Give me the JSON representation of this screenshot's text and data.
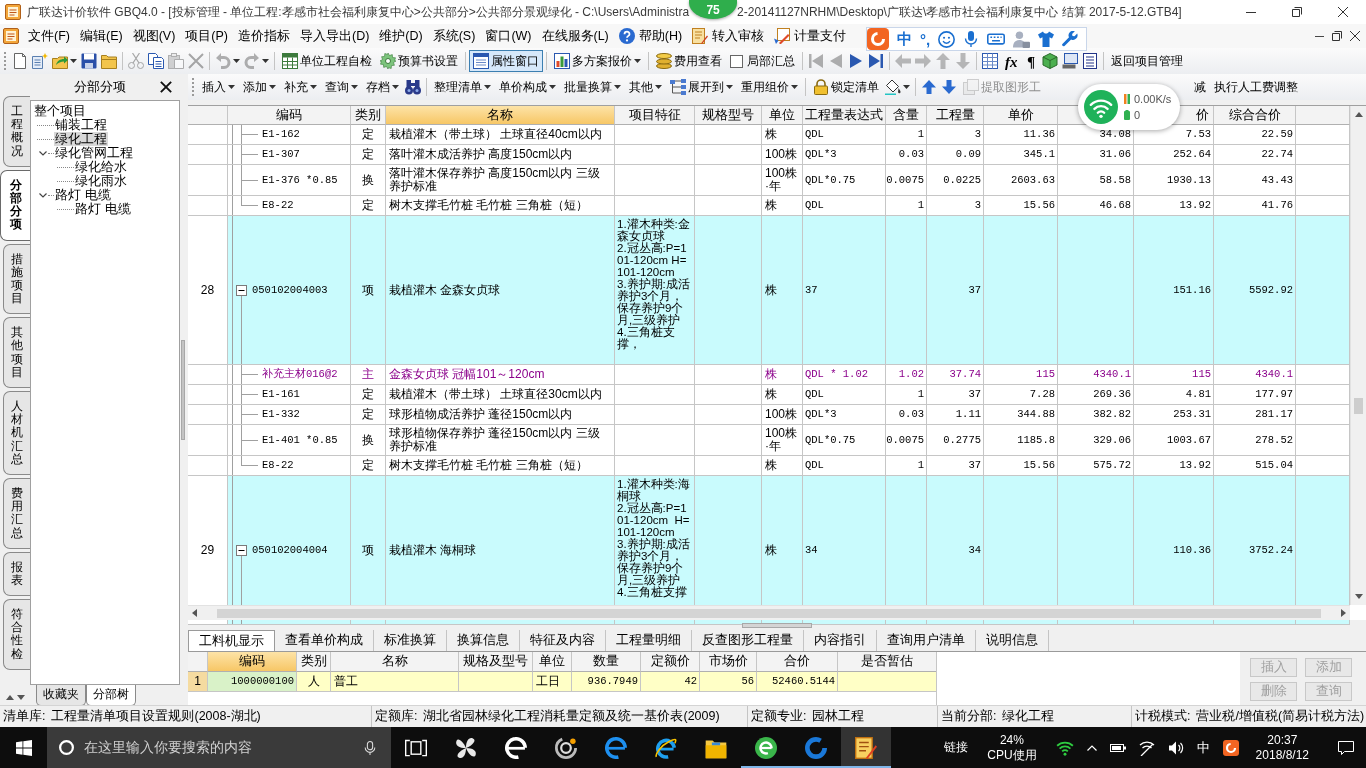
{
  "window": {
    "title_parts": [
      "广联达计价软件 GBQ4.0 - [投标管理 - 单位工程:孝感市社会福利康复中心>公共部分>公共部分景观绿化 - C:\\Users\\Administra",
      "2-20141127NRHM\\Desktop\\广联达\\孝感市社会福利康复中心 结算 2017-5-12.GTB4]"
    ],
    "badge": "75"
  },
  "menu": [
    {
      "label": "文件(F)",
      "kind": "plain"
    },
    {
      "label": "编辑(E)",
      "kind": "plain"
    },
    {
      "label": "视图(V)",
      "kind": "plain"
    },
    {
      "label": "项目(P)",
      "kind": "plain"
    },
    {
      "label": "造价指标",
      "kind": "plain"
    },
    {
      "label": "导入导出(D)",
      "kind": "plain"
    },
    {
      "label": "维护(D)",
      "kind": "plain"
    },
    {
      "label": "系统(S)",
      "kind": "plain"
    },
    {
      "label": "窗口(W)",
      "kind": "plain"
    },
    {
      "label": "在线服务(L)",
      "kind": "plain"
    },
    {
      "label": "帮助(H)",
      "kind": "help"
    },
    {
      "label": "转入审核",
      "kind": "review"
    },
    {
      "label": "计量支付",
      "kind": "payment"
    }
  ],
  "ime_toolbar": {
    "mode": "中",
    "punctuation": "°,"
  },
  "toolbar": {
    "items": [
      {
        "kind": "icon",
        "disabled": false
      },
      {
        "kind": "icon",
        "disabled": false
      },
      {
        "kind": "icon",
        "disabled": false,
        "dropdown": true
      },
      {
        "kind": "icon",
        "disabled": false
      },
      {
        "kind": "icon",
        "disabled": false
      },
      {
        "kind": "separator"
      },
      {
        "kind": "icon",
        "disabled": true
      },
      {
        "kind": "icon",
        "disabled": false
      },
      {
        "kind": "icon",
        "disabled": true
      },
      {
        "kind": "icon",
        "disabled": true
      },
      {
        "kind": "separator"
      },
      {
        "kind": "icon",
        "disabled": true,
        "dropdown": true
      },
      {
        "kind": "icon",
        "disabled": true,
        "dropdown": true
      },
      {
        "kind": "separator"
      },
      {
        "kind": "button",
        "label": "单位工程自检",
        "pressed": false
      },
      {
        "kind": "button",
        "label": "预算书设置",
        "pressed": false
      },
      {
        "kind": "separator"
      },
      {
        "kind": "button",
        "label": "属性窗口",
        "pressed": true
      },
      {
        "kind": "separator"
      },
      {
        "kind": "button",
        "label": "多方案报价",
        "pressed": false,
        "dropdown": true
      },
      {
        "kind": "separator"
      },
      {
        "kind": "button",
        "label": "费用查看",
        "pressed": false
      },
      {
        "kind": "checkbox",
        "label": "局部汇总",
        "checked": false
      },
      {
        "kind": "separator"
      },
      {
        "kind": "icon",
        "disabled": true
      },
      {
        "kind": "icon",
        "disabled": true
      },
      {
        "kind": "icon",
        "disabled": false
      },
      {
        "kind": "icon",
        "disabled": false
      },
      {
        "kind": "separator"
      },
      {
        "kind": "icon",
        "disabled": true
      },
      {
        "kind": "icon",
        "disabled": true
      },
      {
        "kind": "icon",
        "disabled": true
      },
      {
        "kind": "icon",
        "disabled": true
      },
      {
        "kind": "separator"
      },
      {
        "kind": "icon",
        "disabled": false
      },
      {
        "kind": "glyph",
        "label": "fx"
      },
      {
        "kind": "glyph",
        "label": "¶"
      },
      {
        "kind": "icon",
        "disabled": false
      },
      {
        "kind": "icon",
        "disabled": false
      },
      {
        "kind": "icon",
        "disabled": false
      },
      {
        "kind": "separator"
      },
      {
        "kind": "button",
        "label": "返回项目管理",
        "pressed": false
      }
    ]
  },
  "side_tabs": [
    {
      "label": "工程概况",
      "selected": false
    },
    {
      "label": "分部分项",
      "selected": true
    },
    {
      "label": "措施项目",
      "selected": false
    },
    {
      "label": "其他项目",
      "selected": false
    },
    {
      "label": "人材机汇总",
      "selected": false
    },
    {
      "label": "费用汇总",
      "selected": false
    },
    {
      "label": "报表",
      "selected": false
    },
    {
      "label": "符合性检",
      "selected": false
    }
  ],
  "tree_panel": {
    "title": "分部分项",
    "tree": [
      {
        "label": "整个项目",
        "selected": false,
        "children": [
          {
            "label": "铺装工程",
            "selected": false
          },
          {
            "label": "绿化工程",
            "selected": true
          },
          {
            "label": "绿化管网工程",
            "selected": false,
            "expanded": true,
            "children": [
              {
                "label": "绿化给水",
                "selected": false
              },
              {
                "label": "绿化雨水",
                "selected": false
              }
            ]
          },
          {
            "label": "路灯 电缆",
            "selected": false,
            "expanded": true,
            "children": [
              {
                "label": "路灯 电缆",
                "selected": false
              }
            ]
          }
        ]
      }
    ],
    "tabs": [
      {
        "label": "收藏夹",
        "selected": false
      },
      {
        "label": "分部树",
        "selected": true
      }
    ]
  },
  "toolbar2": {
    "items": [
      {
        "kind": "button",
        "label": "插入",
        "disabled": false,
        "dropdown": true
      },
      {
        "kind": "button",
        "label": "添加",
        "disabled": false,
        "dropdown": true
      },
      {
        "kind": "button",
        "label": "补充",
        "disabled": false,
        "dropdown": true
      },
      {
        "kind": "button",
        "label": "查询",
        "disabled": false,
        "dropdown": true
      },
      {
        "kind": "button",
        "label": "存档",
        "disabled": false,
        "dropdown": true
      },
      {
        "kind": "icon",
        "disabled": false
      },
      {
        "kind": "separator"
      },
      {
        "kind": "button",
        "label": "整理清单",
        "disabled": false,
        "dropdown": true
      },
      {
        "kind": "button",
        "label": "单价构成",
        "disabled": false,
        "dropdown": true
      },
      {
        "kind": "button",
        "label": "批量换算",
        "disabled": false,
        "dropdown": true
      },
      {
        "kind": "button",
        "label": "其他",
        "disabled": false,
        "dropdown": true
      },
      {
        "kind": "button",
        "label": "展开到",
        "disabled": false,
        "dropdown": true
      },
      {
        "kind": "button",
        "label": "重用组价",
        "disabled": false,
        "dropdown": true
      },
      {
        "kind": "separator"
      },
      {
        "kind": "button",
        "label": "锁定清单",
        "disabled": false
      },
      {
        "kind": "icon",
        "disabled": false,
        "dropdown": true
      },
      {
        "kind": "separator"
      },
      {
        "kind": "icon",
        "disabled": false
      },
      {
        "kind": "icon",
        "disabled": false
      },
      {
        "kind": "button",
        "label": "提取图形工",
        "disabled": true
      },
      {
        "kind": "button",
        "label": "减",
        "disabled": false
      },
      {
        "kind": "button",
        "label": "执行人工费调整",
        "disabled": false
      }
    ]
  },
  "net_widget": {
    "speed": "0.00K/s",
    "count": "0"
  },
  "table": {
    "columns": [
      {
        "selected": false
      },
      {
        "label": "编码",
        "selected": false
      },
      {
        "label": "类别",
        "selected": false
      },
      {
        "label": "名称",
        "selected": true
      },
      {
        "label": "项目特征",
        "selected": false
      },
      {
        "label": "规格型号",
        "selected": false
      },
      {
        "label": "单位",
        "selected": false
      },
      {
        "label": "工程量表达式",
        "selected": false
      },
      {
        "label": "含量",
        "selected": false
      },
      {
        "label": "工程量",
        "selected": false
      },
      {
        "label": "单价",
        "selected": false
      },
      {
        "selected": false
      },
      {
        "label": "价",
        "selected": false
      },
      {
        "label": "综合合价",
        "selected": false
      }
    ],
    "rows": [
      {
        "kind": "quota",
        "code": "E1-162",
        "category": "定",
        "name": "栽植灌木（带土球） 土球直径40cm以内",
        "unit": "株",
        "expression": "QDL",
        "content": "1",
        "quantity": "3",
        "unit_price": "11.36",
        "column_12": "34.08",
        "column_13": "7.53",
        "total": "22.59"
      },
      {
        "kind": "quota",
        "code": "E1-307",
        "category": "定",
        "name": "落叶灌木成活养护 高度150cm以内",
        "unit": "100株",
        "expression": "QDL*3",
        "content": "0.03",
        "quantity": "0.09",
        "unit_price": "345.1",
        "column_12": "31.06",
        "column_13": "252.64",
        "total": "22.74"
      },
      {
        "kind": "quota",
        "code": "E1-376 *0.85",
        "category": "换",
        "name": "落叶灌木保存养护 高度150cm以内 三级养护标准",
        "unit": "100株·年",
        "expression": "QDL*0.75",
        "content": "0.0075",
        "quantity": "0.0225",
        "unit_price": "2603.63",
        "column_12": "58.58",
        "column_13": "1930.13",
        "total": "43.43"
      },
      {
        "kind": "quota",
        "code": "E8-22",
        "category": "定",
        "name": "树木支撑毛竹桩 毛竹桩 三角桩（短）",
        "unit": "株",
        "expression": "QDL",
        "content": "1",
        "quantity": "3",
        "unit_price": "15.56",
        "column_12": "46.68",
        "column_13": "13.92",
        "total": "41.76"
      },
      {
        "kind": "item",
        "index": "28",
        "expanded": true,
        "code": "050102004003",
        "category": "项",
        "name": "栽植灌木 金森女贞球",
        "features": "1.灌木种类:金森女贞球\n2.冠丛高:P=101-120cm H=101-120cm\n3.养护期:成活养护3个月，保存养护9个月,三级养护\n4.三角桩支撑，",
        "unit": "株",
        "expression": "37",
        "quantity": "37",
        "column_13": "151.16",
        "total": "5592.92"
      },
      {
        "kind": "material",
        "code": "补充主材016@2",
        "category": "主",
        "name": "金森女贞球 冠幅101～120cm",
        "unit": "株",
        "expression": "QDL * 1.02",
        "content": "1.02",
        "quantity": "37.74",
        "unit_price": "115",
        "column_12": "4340.1",
        "column_13": "115",
        "total": "4340.1"
      },
      {
        "kind": "quota",
        "code": "E1-161",
        "category": "定",
        "name": "栽植灌木（带土球） 土球直径30cm以内",
        "unit": "株",
        "expression": "QDL",
        "content": "1",
        "quantity": "37",
        "unit_price": "7.28",
        "column_12": "269.36",
        "column_13": "4.81",
        "total": "177.97"
      },
      {
        "kind": "quota",
        "code": "E1-332",
        "category": "定",
        "name": "球形植物成活养护 蓬径150cm以内",
        "unit": "100株",
        "expression": "QDL*3",
        "content": "0.03",
        "quantity": "1.11",
        "unit_price": "344.88",
        "column_12": "382.82",
        "column_13": "253.31",
        "total": "281.17"
      },
      {
        "kind": "quota",
        "code": "E1-401 *0.85",
        "category": "换",
        "name": "球形植物保存养护 蓬径150cm以内 三级养护标准",
        "unit": "100株·年",
        "expression": "QDL*0.75",
        "content": "0.0075",
        "quantity": "0.2775",
        "unit_price": "1185.8",
        "column_12": "329.06",
        "column_13": "1003.67",
        "total": "278.52"
      },
      {
        "kind": "quota",
        "code": "E8-22",
        "category": "定",
        "name": "树木支撑毛竹桩 毛竹桩 三角桩（短）",
        "unit": "株",
        "expression": "QDL",
        "content": "1",
        "quantity": "37",
        "unit_price": "15.56",
        "column_12": "575.72",
        "column_13": "13.92",
        "total": "515.04"
      },
      {
        "kind": "item",
        "index": "29",
        "expanded": true,
        "code": "050102004004",
        "category": "项",
        "name": "栽植灌木 海桐球",
        "features": "1.灌木种类:海桐球\n2.冠丛高:P=101-120cm  H=101-120cm\n3.养护期:成活养护3个月，保存养护9个月,三级养护\n4.三角桩支撑",
        "unit": "株",
        "expression": "34",
        "quantity": "34",
        "column_13": "110.36",
        "total": "3752.24"
      }
    ]
  },
  "detail_tabs": [
    {
      "label": "工料机显示",
      "selected": true
    },
    {
      "label": "查看单价构成",
      "selected": false
    },
    {
      "label": "标准换算",
      "selected": false
    },
    {
      "label": "换算信息",
      "selected": false
    },
    {
      "label": "特征及内容",
      "selected": false
    },
    {
      "label": "工程量明细",
      "selected": false
    },
    {
      "label": "反查图形工程量",
      "selected": false
    },
    {
      "label": "内容指引",
      "selected": false
    },
    {
      "label": "查询用户清单",
      "selected": false
    },
    {
      "label": "说明信息",
      "selected": false
    }
  ],
  "detail_table": {
    "columns": [
      {
        "selected": false
      },
      {
        "label": "编码",
        "selected": true
      },
      {
        "label": "类别",
        "selected": false
      },
      {
        "label": "名称",
        "selected": false
      },
      {
        "label": "规格及型号",
        "selected": false
      },
      {
        "label": "单位",
        "selected": false
      },
      {
        "label": "数量",
        "selected": false
      },
      {
        "label": "定额价",
        "selected": false
      },
      {
        "label": "市场价",
        "selected": false
      },
      {
        "label": "合价",
        "selected": false
      },
      {
        "label": "是否暂估",
        "selected": false
      }
    ],
    "rows": [
      {
        "index": "1",
        "code": "1000000100",
        "category": "人",
        "name": "普工",
        "unit": "工日",
        "quantity": "936.7949",
        "base_price": "42",
        "market_price": "56",
        "total": "52460.5144",
        "selected": true
      }
    ]
  },
  "detail_buttons": [
    {
      "label": "插入",
      "disabled": true
    },
    {
      "label": "添加",
      "disabled": true
    },
    {
      "label": "删除",
      "disabled": true
    },
    {
      "label": "查询",
      "disabled": true
    }
  ],
  "status_bar": [
    {
      "label": "清单库:",
      "value": "工程量清单项目设置规则(2008-湖北)"
    },
    {
      "label": "定额库:",
      "value": "湖北省园林绿化工程消耗量定额及统一基价表(2009)"
    },
    {
      "label": "定额专业:",
      "value": "园林工程"
    },
    {
      "label": "当前分部:",
      "value": "绿化工程"
    },
    {
      "label": "计税模式:",
      "value": "营业税/增值税(简易计税方法)"
    }
  ],
  "taskbar": {
    "search": {
      "placeholder": "在这里输入你要搜索的内容"
    },
    "apps": [
      {
        "running": false,
        "active": false
      },
      {
        "running": false,
        "active": false
      },
      {
        "running": false,
        "active": false
      },
      {
        "running": false,
        "active": false
      },
      {
        "running": false,
        "active": false
      },
      {
        "running": false,
        "active": false
      },
      {
        "running": false,
        "active": false
      },
      {
        "running": true,
        "active": false
      },
      {
        "running": true,
        "active": false
      },
      {
        "running": true,
        "active": true
      }
    ],
    "tray": {
      "link": "链接",
      "cpu_usage": "24%",
      "cpu_label": "CPU使用",
      "ime": "中",
      "time": "20:37",
      "date": "2018/8/12"
    }
  }
}
